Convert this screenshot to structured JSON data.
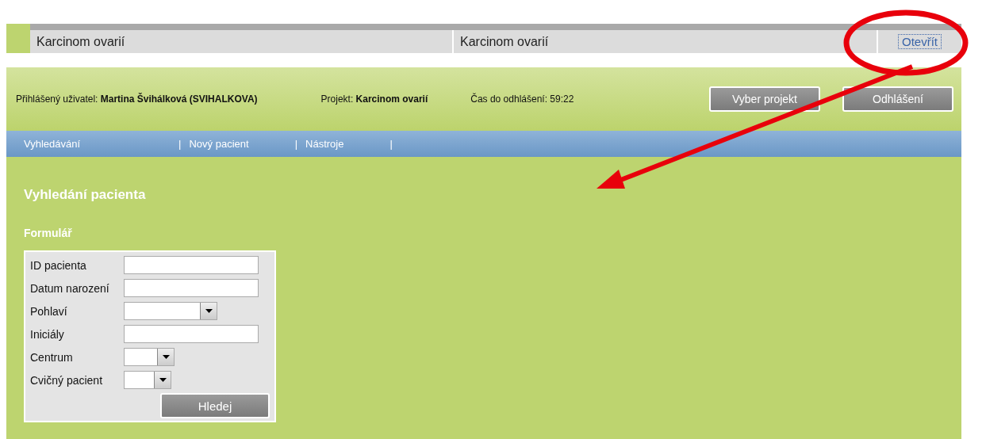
{
  "result_row": {
    "cells": [
      "Karcinom ovarií",
      "Karcinom ovarií"
    ],
    "action": "Otevřít"
  },
  "header": {
    "user_label": "Přihlášený uživatel:",
    "user": "Martina Švihálková (SVIHALKOVA)",
    "project_label": "Projekt:",
    "project": "Karcinom ovarií",
    "timeout": "Čas do odhlášení: 59:22",
    "buttons": [
      "Vyber projekt",
      "Odhlášení"
    ]
  },
  "nav": [
    {
      "kind": "link",
      "label": "Vyhledávání"
    },
    {
      "kind": "separator",
      "label": "|"
    },
    {
      "kind": "link",
      "label": "Nový pacient"
    },
    {
      "kind": "separator",
      "label": "|"
    },
    {
      "kind": "link",
      "label": "Nástroje"
    },
    {
      "kind": "separator",
      "label": "|"
    }
  ],
  "page_title": "Vyhledání pacienta",
  "section_title": "Formulář",
  "form": {
    "fields": [
      {
        "label": "ID pacienta",
        "kind": "text"
      },
      {
        "label": "Datum narození",
        "kind": "text"
      },
      {
        "label": "Pohlaví",
        "kind": "select"
      },
      {
        "label": "Iniciály",
        "kind": "text"
      },
      {
        "label": "Centrum",
        "kind": "select"
      },
      {
        "label": "Cvičný pacient",
        "kind": "select"
      }
    ],
    "submit": "Hledej"
  },
  "annotations": {
    "circled_link": true,
    "arrow": true
  }
}
